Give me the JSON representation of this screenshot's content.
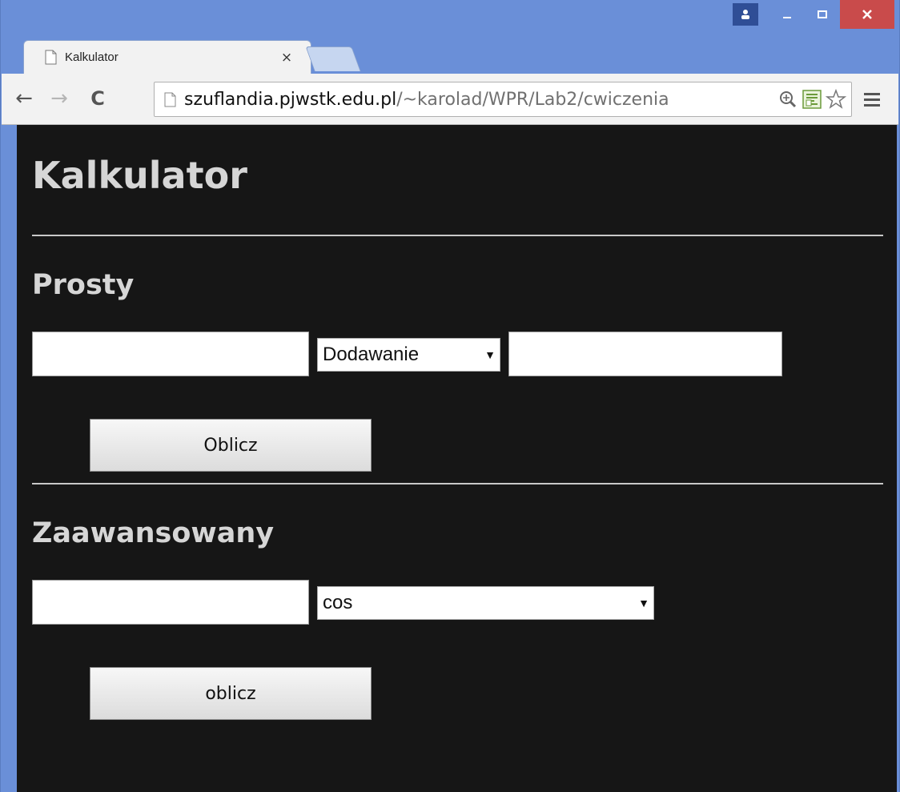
{
  "browser": {
    "tab_title": "Kalkulator",
    "tab_close": "×",
    "url_host": "szuflandia.pjwstk.edu.pl",
    "url_path": "/~karolad/WPR/Lab2/cwiczenia",
    "back_glyph": "←",
    "forward_glyph": "→",
    "reload_glyph": "C"
  },
  "page": {
    "title": "Kalkulator",
    "simple": {
      "heading": "Prosty",
      "input_a_value": "",
      "operation_selected": "Dodawanie",
      "input_b_value": "",
      "button_label": "Oblicz"
    },
    "advanced": {
      "heading": "Zaawansowany",
      "input_value": "",
      "function_selected": "cos",
      "button_label": "oblicz"
    }
  },
  "icons": {
    "profile": "user-icon",
    "minimize": "minimize-icon",
    "maximize": "maximize-icon",
    "close": "close-icon",
    "page": "document-icon",
    "zoom": "zoom-icon",
    "rss": "rss-extension-icon",
    "bookmark": "star-icon",
    "menu": "menu-icon"
  },
  "colors": {
    "page_background": "#161616",
    "heading_text": "#d6d6d6",
    "close_button": "#c94b4b",
    "chrome_frame": "#6a8fd8"
  }
}
